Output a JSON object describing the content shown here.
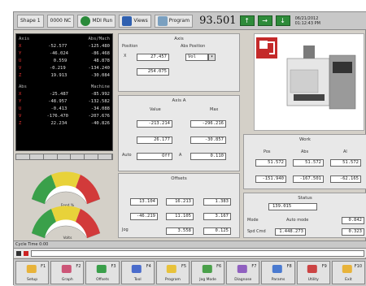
{
  "toolbar": {
    "item1": "Shape 1",
    "item2": "0000 NC",
    "item3": "MDI Run",
    "item4": "Views",
    "item5": "Program",
    "counter": "93.501",
    "datetime_line1": "06/21/2012",
    "datetime_line2": "01:12:43 PM"
  },
  "axis_panel": {
    "header1_left": "Axis",
    "header1_right": "Abs/Mach",
    "rows1": [
      {
        "axis": "X",
        "v1": "-52.577",
        "v2": "-125.480"
      },
      {
        "axis": "Y",
        "v1": "-46.024",
        "v2": "-86.468"
      },
      {
        "axis": "U",
        "v1": "0.559",
        "v2": "48.878"
      },
      {
        "axis": "V",
        "v1": "-0.219",
        "v2": "-134.240"
      },
      {
        "axis": "Z",
        "v1": "19.913",
        "v2": "-30.084"
      }
    ],
    "header2_left": "Abs",
    "header2_right": "Machine",
    "rows2": [
      {
        "axis": "X",
        "v1": "-25.487",
        "v2": "-85.992"
      },
      {
        "axis": "Y",
        "v1": "-48.957",
        "v2": "-132.582"
      },
      {
        "axis": "U",
        "v1": "-0.413",
        "v2": "-34.088"
      },
      {
        "axis": "V",
        "v1": "-176.470",
        "v2": "-207.676"
      },
      {
        "axis": "Z",
        "v1": "22.234",
        "v2": "-40.826"
      }
    ]
  },
  "gauges": [
    {
      "label": "Feed %",
      "level": 0.5
    },
    {
      "label": "Volts",
      "level": 0.5
    }
  ],
  "box_top": {
    "title": "Axis",
    "label_left": "Position",
    "label_right": "Abs Position",
    "label_x": "X",
    "value1": "27.457",
    "select_value": "Vol",
    "value2": "254.075"
  },
  "box_mid": {
    "title": "Axis A",
    "col1": "Value",
    "col2": "Max",
    "r1_v1": "-213.214",
    "r1_v2": "-296.216",
    "r2_v1": "26.177",
    "r2_v2": "-30.857",
    "r3_label": "Auto",
    "r3_v1": "Off",
    "r3_label2": "A",
    "r3_v2": "0.110"
  },
  "box_bottom": {
    "title": "Offsets",
    "r1": [
      "13.104",
      "16.213",
      "1.383"
    ],
    "r2": [
      "-46.219",
      "11.105",
      "3.167"
    ],
    "r3_label": "Jog",
    "r3_v1": "3.558",
    "r3_v2": "0.125"
  },
  "box_right": {
    "title": "Work",
    "col1": "Pos",
    "col2": "Abs",
    "col3": "Al",
    "r1": [
      "51.572",
      "51.572",
      "51.572"
    ],
    "r2": [
      "-151.940",
      "-167.501",
      "-62.165"
    ]
  },
  "box_right2": {
    "title": "Status",
    "field1": "139.015",
    "label_a": "Mode",
    "label_b": "Auto mode",
    "value_b": "0.842",
    "label_c": "Spd Cmd",
    "value_c1": "1.448.273",
    "value_c2": "0.323"
  },
  "status_bar": "Cycle Time 0:00",
  "bottom_buttons": [
    {
      "label": "Setup",
      "key": "F1",
      "color": "#e8b33a"
    },
    {
      "label": "Graph",
      "key": "F2",
      "color": "#cc5577"
    },
    {
      "label": "Offsets",
      "key": "F3",
      "color": "#3a9f4a"
    },
    {
      "label": "Tool",
      "key": "F4",
      "color": "#4a6ccc"
    },
    {
      "label": "Program",
      "key": "F5",
      "color": "#e8c23a"
    },
    {
      "label": "Jog Mode",
      "key": "F6",
      "color": "#4aa04a"
    },
    {
      "label": "Diagnose",
      "key": "F7",
      "color": "#9060c0"
    },
    {
      "label": "Params",
      "key": "F8",
      "color": "#4a7ad0"
    },
    {
      "label": "Utility",
      "key": "F9",
      "color": "#cc4444"
    },
    {
      "label": "Exit",
      "key": "F10",
      "color": "#e8b33a"
    }
  ]
}
